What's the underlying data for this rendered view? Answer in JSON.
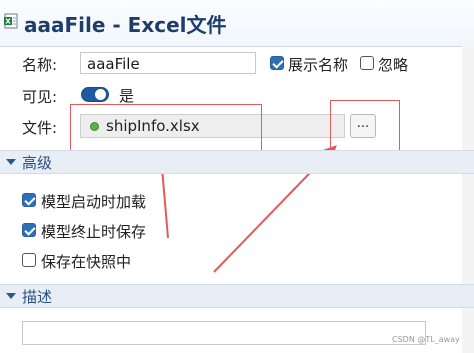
{
  "window": {
    "title": "aaaFile - Excel文件",
    "title_icon": "excel-file-icon"
  },
  "form": {
    "name_label": "名称:",
    "name_value": "aaaFile",
    "show_name_label": "展示名称",
    "show_name_checked": true,
    "ignore_label": "忽略",
    "ignore_checked": false,
    "visible_label": "可见:",
    "visible_value": "是",
    "visible_on": true,
    "file_label": "文件:",
    "file_value": "shipInfo.xlsx",
    "file_status_icon": "green-dot-icon",
    "browse_label": "..."
  },
  "advanced": {
    "title": "高级",
    "options": [
      {
        "label": "模型启动时加载",
        "checked": true
      },
      {
        "label": "模型终止时保存",
        "checked": true
      },
      {
        "label": "保存在快照中",
        "checked": false
      }
    ]
  },
  "description": {
    "title": "描述",
    "value": ""
  },
  "watermark": "CSDN @TL_away",
  "colors": {
    "accent": "#2f6fb6",
    "title_text": "#1f3d6b",
    "annotation_red": "#e35a5a",
    "status_green": "#5fb04a"
  }
}
